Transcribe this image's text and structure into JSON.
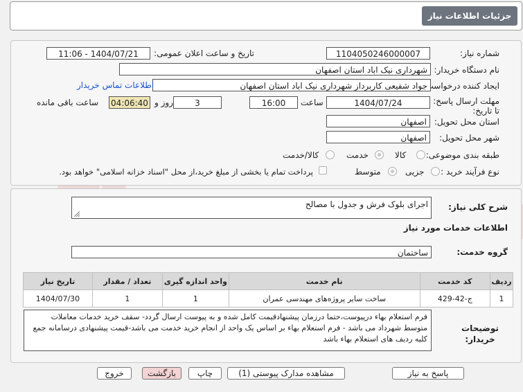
{
  "title": "جزئيات اطلاعات نياز",
  "fields": {
    "need_number_label": "شماره نياز:",
    "need_number": "1104050246000007",
    "announce_label": "تاريخ و ساعت اعلان عمومی:",
    "announce_value": "1404/07/21 - 11:06",
    "buyer_label": "نام دستگاه خريدار:",
    "buyer_value": "شهرداری نیک اباد استان اصفهان",
    "creator_label": "ايجاد کننده درخواست:",
    "creator_value": "جواد شفیعی کاربرداز شهرداری نیک اباد استان اصفهان",
    "contact_link": "اطلاعات تماس خريدار",
    "deadline_label": "مهلت ارسال پاسخ: تا تاریخ:",
    "deadline_date": "1404/07/24",
    "time_label": "ساعت",
    "deadline_time": "16:00",
    "days_value": "3",
    "days_label": "روز و",
    "remaining_time": "04:06:40",
    "remaining_label": "ساعت باقی مانده",
    "province_label": "استان محل تحويل:",
    "province_value": "اصفهان",
    "city_label": "شهر محل تحويل:",
    "city_value": "اصفهان",
    "category_label": "طبقه بندی موضوعی:",
    "category_options": [
      "کالا",
      "خدمت",
      "کالا/خدمت"
    ],
    "process_label": "نوع فرآيند خريد :",
    "process_options": [
      "جزيی",
      "متوسط"
    ],
    "payment_note": "پرداخت تمام یا بخشی از مبلغ خرید،از محل \"اسناد خزانه اسلامی\" خواهد بود."
  },
  "need_desc": {
    "label": "شرح کلی نياز:",
    "value": "اجرای بلوک فرش و جدول با مصالح"
  },
  "services": {
    "section_title": "اطلاعات خدمات مورد نياز",
    "group_label": "گروه خدمت:",
    "group_value": "ساختمان",
    "columns": [
      "رديف",
      "کد خدمت",
      "نام خدمت",
      "واحد اندازه گيری",
      "تعداد / مقدار",
      "تاريخ نياز"
    ],
    "rows": [
      [
        "1",
        "ج-42-429",
        "ساخت سایر پروژه‌های مهندسی عمران",
        "1",
        "1",
        "1404/07/30"
      ]
    ]
  },
  "buyer_notes": {
    "label": "توضيحات خريدار:",
    "text": "فرم استعلام بهاء درپیوست،حتما درزمان پیشنهادقیمت کامل شده و به پیوست ارسال گردد- سقف خرید خدمات معاملات متوسط شهرداد می باشد - فرم استعلام بهاء بر اساس یک واحد از انجام خرید خدمت می باشد-قیمت پیشنهادی درسامانه جمع کلیه ردیف های استعلام بهاء باشد"
  },
  "buttons": {
    "reply": "پاسخ به نياز",
    "attachments": "مشاهده مدارک پيوستی (1)",
    "print": "چاپ",
    "back": "بازگشت",
    "exit": "خروج"
  },
  "watermark": "AriaTender.net",
  "colors": {
    "title_bg": "#6d747e",
    "link": "#1a55c9",
    "remaining_bg": "#f0e6b4",
    "pink_button": "#f3d3d3"
  }
}
